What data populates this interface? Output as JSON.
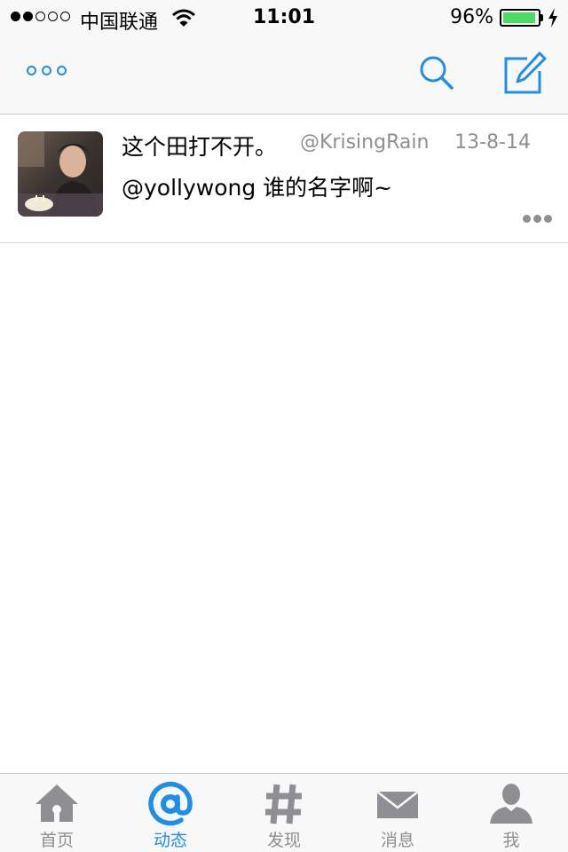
{
  "status_bar": {
    "carrier": "中国联通",
    "time": "11:01",
    "battery_percent": "96%",
    "battery_level": 0.96,
    "signal_strength": 2,
    "signal_max": 5
  },
  "nav_bar": {
    "more_icon": "more-icon",
    "search_icon": "search-icon",
    "compose_icon": "compose-icon",
    "accent_color": "#1f8ee8"
  },
  "feed": [
    {
      "user_name": "这个田打不开。",
      "handle": "@KrisingRain",
      "date": "13-8-14",
      "text": "@yollywong 谁的名字啊~"
    }
  ],
  "tab_bar": {
    "tabs": [
      {
        "label": "首页",
        "icon": "home-icon",
        "active": false
      },
      {
        "label": "动态",
        "icon": "at-icon",
        "active": true
      },
      {
        "label": "发现",
        "icon": "hashtag-icon",
        "active": false
      },
      {
        "label": "消息",
        "icon": "mail-icon",
        "active": false
      },
      {
        "label": "我",
        "icon": "person-icon",
        "active": false
      }
    ]
  }
}
